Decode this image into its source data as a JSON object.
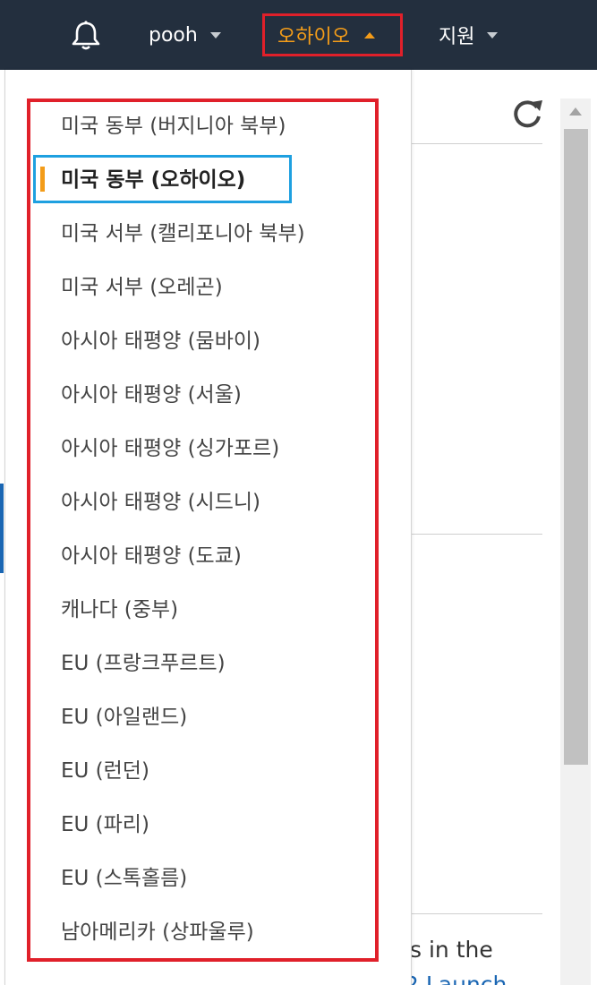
{
  "header": {
    "user_label": "pooh",
    "region_label": "오하이오",
    "support_label": "지원"
  },
  "background": {
    "text_fragment": "s in the",
    "link_fragment": "2 Launch"
  },
  "region_menu": {
    "items": [
      {
        "label": "미국 동부 (버지니아 북부)",
        "selected": false
      },
      {
        "label": "미국 동부 (오하이오)",
        "selected": true
      },
      {
        "label": "미국 서부 (캘리포니아 북부)",
        "selected": false
      },
      {
        "label": "미국 서부 (오레곤)",
        "selected": false
      },
      {
        "label": "아시아 태평양 (뭄바이)",
        "selected": false
      },
      {
        "label": "아시아 태평양 (서울)",
        "selected": false
      },
      {
        "label": "아시아 태평양 (싱가포르)",
        "selected": false
      },
      {
        "label": "아시아 태평양 (시드니)",
        "selected": false
      },
      {
        "label": "아시아 태평양 (도쿄)",
        "selected": false
      },
      {
        "label": "캐나다 (중부)",
        "selected": false
      },
      {
        "label": "EU (프랑크푸르트)",
        "selected": false
      },
      {
        "label": "EU (아일랜드)",
        "selected": false
      },
      {
        "label": "EU (런던)",
        "selected": false
      },
      {
        "label": "EU (파리)",
        "selected": false
      },
      {
        "label": "EU (스톡홀름)",
        "selected": false
      },
      {
        "label": "남아메리카 (상파울루)",
        "selected": false
      }
    ]
  },
  "colors": {
    "navbar": "#232f3e",
    "region_accent": "#f39c19",
    "annotation_red": "#e0202a",
    "annotation_blue": "#1ea0e0"
  },
  "icons": {
    "bell": "bell-icon",
    "refresh": "refresh-icon"
  }
}
